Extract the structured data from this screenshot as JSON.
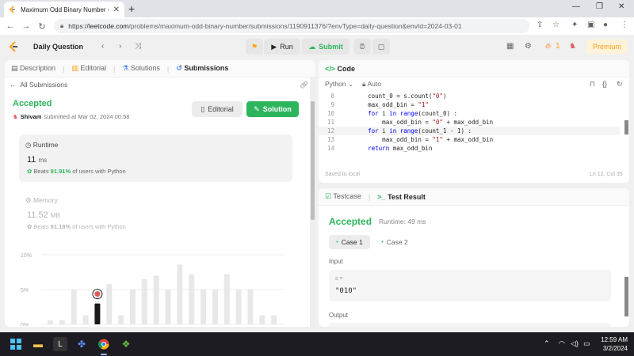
{
  "browser": {
    "tab_title": "Maximum Odd Binary Number -",
    "new_tab": "+",
    "url_host": "leetcode.com",
    "url_path": "/problems/maximum-odd-binary-number/submissions/1190911376/?envType=daily-question&envId=2024-03-01",
    "url_prefix": "https://"
  },
  "topbar": {
    "title": "Daily Question",
    "run": "Run",
    "submit": "Submit",
    "streak": "1",
    "premium": "Premium"
  },
  "left_panel": {
    "tabs": [
      "Description",
      "Editorial",
      "Solutions",
      "Submissions"
    ],
    "all_submissions": "All Submissions",
    "status": "Accepted",
    "user": "Shivam",
    "submitted_at": "submitted at Mar 02, 2024 00:58",
    "editorial_btn": "Editorial",
    "solution_btn": "Solution",
    "runtime": {
      "label": "Runtime",
      "value": "11",
      "unit": "ms",
      "beats_prefix": "Beats",
      "beats_pct": "91.91%",
      "beats_suffix": "of users with Python"
    },
    "memory": {
      "label": "Memory",
      "value": "11.52",
      "unit": "MB",
      "beats_prefix": "Beats",
      "beats_pct": "91.18%",
      "beats_suffix": "of users with Python"
    }
  },
  "chart_data": {
    "type": "bar",
    "y_ticks": [
      "10%",
      "5%",
      "0%"
    ],
    "ylim": [
      0,
      10
    ],
    "values": [
      0.6,
      0.6,
      5.0,
      1.3,
      3.0,
      5.8,
      1.3,
      5.0,
      6.5,
      7.0,
      5.0,
      8.6,
      7.2,
      5.0,
      5.0,
      7.2,
      5.0,
      5.0,
      1.3,
      1.3
    ],
    "highlight_index": 4,
    "colors": {
      "bar": "#e8e8e8",
      "highlight": "#1a1a1a",
      "grid": "#eeeeee"
    }
  },
  "code_panel": {
    "title": "Code",
    "language": "Python",
    "mode": "Auto",
    "lines": [
      {
        "n": "8",
        "t": "        count_0 = s.count(\"0\")"
      },
      {
        "n": "9",
        "t": "        max_odd_bin = \"1\""
      },
      {
        "n": "10",
        "t": "        for i in range(count_0) :"
      },
      {
        "n": "11",
        "t": "            max_odd_bin = \"0\" + max_odd_bin"
      },
      {
        "n": "12",
        "t": "        for i in range(count_1 - 1) :"
      },
      {
        "n": "13",
        "t": "            max_odd_bin = \"1\" + max_odd_bin"
      },
      {
        "n": "14",
        "t": "        return max_odd_bin"
      }
    ],
    "saved": "Saved to local",
    "cursor": "Ln 12, Col 35"
  },
  "result_panel": {
    "tab_testcase": "Testcase",
    "tab_result": "Test Result",
    "status": "Accepted",
    "runtime": "Runtime: 49 ms",
    "case1": "Case 1",
    "case2": "Case 2",
    "input_label": "Input",
    "input_var": "s =",
    "input_value": "\"010\"",
    "output_label": "Output"
  },
  "taskbar": {
    "time": "12:59 AM",
    "date": "3/2/2024"
  }
}
